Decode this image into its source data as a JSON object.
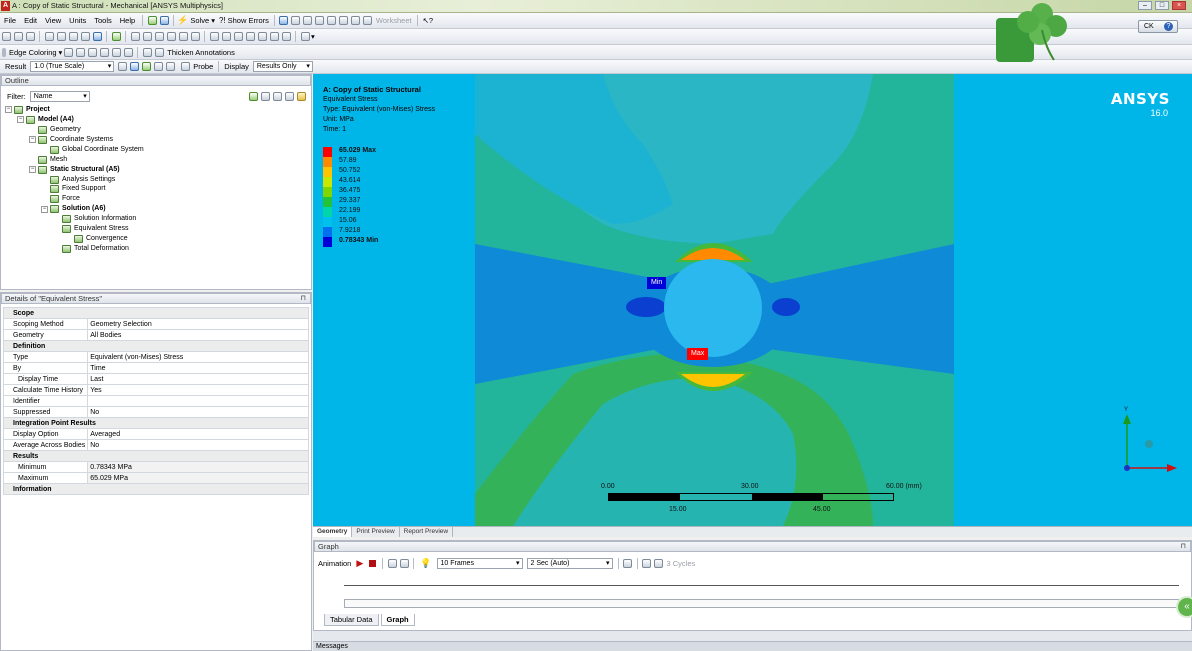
{
  "window": {
    "title": "A : Copy of Static Structural - Mechanical [ANSYS Multiphysics]"
  },
  "menu": [
    "File",
    "Edit",
    "View",
    "Units",
    "Tools",
    "Help"
  ],
  "toolbar": {
    "solve": "Solve",
    "show_errors": "Show Errors",
    "worksheet": "Worksheet"
  },
  "toolbar2": {
    "edge_coloring": "Edge Coloring",
    "thicken_annotations": "Thicken Annotations"
  },
  "toolbar3": {
    "result_label": "Result",
    "result_scale": "1.0 (True Scale)",
    "probe": "Probe",
    "display_label": "Display",
    "display_value": "Results Only"
  },
  "user": {
    "initials": "CK",
    "help": "?"
  },
  "outline": {
    "title": "Outline",
    "filter_label": "Filter:",
    "filter_value": "Name",
    "tree": [
      {
        "label": "Project",
        "level": 0,
        "bold": true
      },
      {
        "label": "Model (A4)",
        "level": 1,
        "bold": true
      },
      {
        "label": "Geometry",
        "level": 2
      },
      {
        "label": "Coordinate Systems",
        "level": 2
      },
      {
        "label": "Global Coordinate System",
        "level": 3
      },
      {
        "label": "Mesh",
        "level": 2
      },
      {
        "label": "Static Structural (A5)",
        "level": 2,
        "bold": true
      },
      {
        "label": "Analysis Settings",
        "level": 3
      },
      {
        "label": "Fixed Support",
        "level": 3
      },
      {
        "label": "Force",
        "level": 3
      },
      {
        "label": "Solution (A6)",
        "level": 3,
        "bold": true
      },
      {
        "label": "Solution Information",
        "level": 4
      },
      {
        "label": "Equivalent Stress",
        "level": 4
      },
      {
        "label": "Convergence",
        "level": 5
      },
      {
        "label": "Total Deformation",
        "level": 4
      }
    ]
  },
  "details": {
    "title": "Details of \"Equivalent Stress\"",
    "rows": [
      {
        "type": "section",
        "label": "Scope"
      },
      {
        "label": "Scoping Method",
        "value": "Geometry Selection"
      },
      {
        "label": "Geometry",
        "value": "All Bodies"
      },
      {
        "type": "section",
        "label": "Definition"
      },
      {
        "label": "Type",
        "value": "Equivalent (von-Mises) Stress"
      },
      {
        "label": "By",
        "value": "Time"
      },
      {
        "label": "Display Time",
        "value": "Last",
        "indent": true
      },
      {
        "label": "Calculate Time History",
        "value": "Yes"
      },
      {
        "label": "Identifier",
        "value": ""
      },
      {
        "label": "Suppressed",
        "value": "No"
      },
      {
        "type": "section",
        "label": "Integration Point Results"
      },
      {
        "label": "Display Option",
        "value": "Averaged"
      },
      {
        "label": "Average Across Bodies",
        "value": "No"
      },
      {
        "type": "section",
        "label": "Results"
      },
      {
        "label": "Minimum",
        "value": "0.78343 MPa",
        "indent": true,
        "shaded": true
      },
      {
        "label": "Maximum",
        "value": "65.029 MPa",
        "indent": true,
        "shaded": true
      },
      {
        "type": "section",
        "label": "Information"
      }
    ]
  },
  "viewport": {
    "info": [
      "A: Copy of Static Structural",
      "Equivalent Stress",
      "Type: Equivalent (von-Mises) Stress",
      "Unit: MPa",
      "Time: 1"
    ],
    "legend": [
      {
        "label": "65.029 Max",
        "color": "#ff0000",
        "bold": true
      },
      {
        "label": "57.89",
        "color": "#ff8a00"
      },
      {
        "label": "50.752",
        "color": "#ffc400"
      },
      {
        "label": "43.614",
        "color": "#c8e800"
      },
      {
        "label": "36.475",
        "color": "#7fd600"
      },
      {
        "label": "29.337",
        "color": "#22c33a"
      },
      {
        "label": "22.199",
        "color": "#00d6a8"
      },
      {
        "label": "15.06",
        "color": "#00c0ee"
      },
      {
        "label": "7.9218",
        "color": "#0070f0"
      },
      {
        "label": "0.78343 Min",
        "color": "#0000d8",
        "bold": true
      }
    ],
    "brand": "ANSYS",
    "version": "16.0",
    "probe_min": "Min",
    "probe_max": "Max",
    "scale": {
      "top": [
        "0.00",
        "30.00",
        "60.00 (mm)"
      ],
      "bottom": [
        "15.00",
        "45.00"
      ]
    },
    "axis_y": "Y"
  },
  "view_tabs": [
    "Geometry",
    "Print Preview",
    "Report Preview"
  ],
  "graph": {
    "title": "Graph",
    "animation": "Animation",
    "frames": "10 Frames",
    "duration": "2 Sec (Auto)",
    "cycles": "3 Cycles",
    "tabs": [
      "Tabular Data",
      "Graph"
    ]
  },
  "status": {
    "messages": "Messages"
  }
}
